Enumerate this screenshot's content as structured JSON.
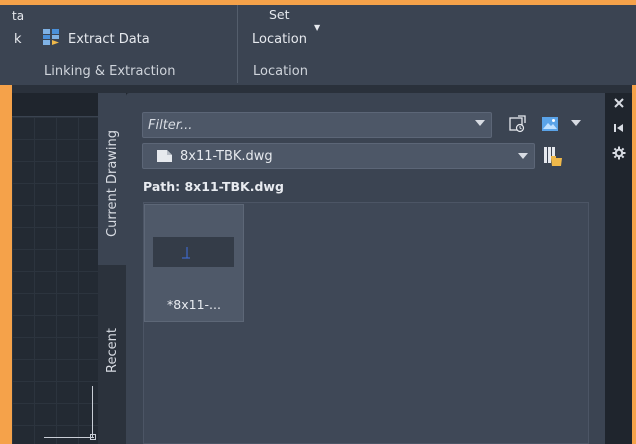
{
  "ribbon": {
    "fragments": [
      "ta",
      "k"
    ],
    "extract_data_label": "Extract  Data",
    "set_location_line1": "Set",
    "set_location_line2": "Location",
    "panel_linking": "Linking & Extraction",
    "panel_location": "Location"
  },
  "palette": {
    "tabs": {
      "current": "Current Drawing",
      "recent": "Recent"
    },
    "filter_placeholder": "Filter...",
    "file_dropdown_value": "8x11-TBK.dwg",
    "path_label": "Path: 8x11-TBK.dwg",
    "thumbnails": [
      {
        "label": "*8x11-..."
      }
    ],
    "side_controls": [
      "close-icon",
      "auto-hide-icon",
      "properties-icon"
    ]
  },
  "colors": {
    "ribbon_bg": "#3b4452",
    "panel_bg": "#3b4452",
    "canvas_bg": "#1f252d",
    "frame_accent": "#f5a24a"
  }
}
